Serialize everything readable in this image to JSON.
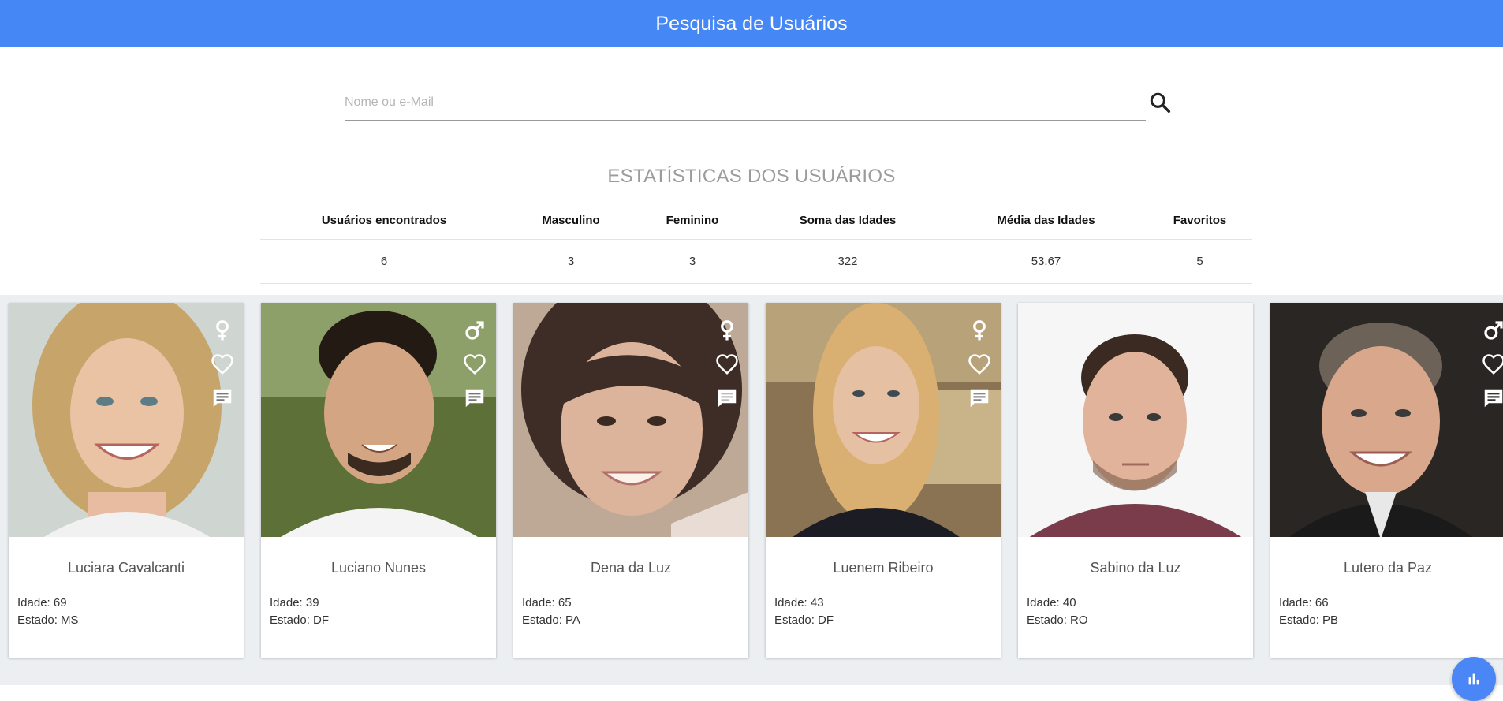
{
  "header": {
    "title": "Pesquisa de Usuários"
  },
  "search": {
    "placeholder": "Nome ou e-Mail",
    "value": ""
  },
  "stats": {
    "title": "ESTATÍSTICAS DOS USUÁRIOS",
    "headers": [
      "Usuários encontrados",
      "Masculino",
      "Feminino",
      "Soma das Idades",
      "Média das Idades",
      "Favoritos"
    ],
    "values": [
      "6",
      "3",
      "3",
      "322",
      "53.67",
      "5"
    ]
  },
  "cards": [
    {
      "name": "Luciara Cavalcanti",
      "age_label": "Idade: 69",
      "state_label": "Estado: MS",
      "gender": "female-icon",
      "photo": "woman-blonde-curly-photo"
    },
    {
      "name": "Luciano Nunes",
      "age_label": "Idade: 39",
      "state_label": "Estado: DF",
      "gender": "male-icon",
      "photo": "man-dark-hair-photo"
    },
    {
      "name": "Dena da Luz",
      "age_label": "Idade: 65",
      "state_label": "Estado: PA",
      "gender": "female-icon",
      "photo": "woman-dark-hair-photo"
    },
    {
      "name": "Luenem Ribeiro",
      "age_label": "Idade: 43",
      "state_label": "Estado: DF",
      "gender": "female-icon",
      "photo": "woman-long-blonde-photo"
    },
    {
      "name": "Sabino da Luz",
      "age_label": "Idade: 40",
      "state_label": "Estado: RO",
      "gender": "",
      "photo": "man-short-hair-photo"
    },
    {
      "name": "Lutero da Paz",
      "age_label": "Idade: 66",
      "state_label": "Estado: PB",
      "gender": "male-icon",
      "photo": "man-grey-hair-photo"
    }
  ],
  "colors": {
    "header": "#4687f6",
    "fab": "#4a86f5",
    "cards_bg": "#eceff2"
  },
  "fab": {
    "icon": "bar-chart-icon"
  }
}
